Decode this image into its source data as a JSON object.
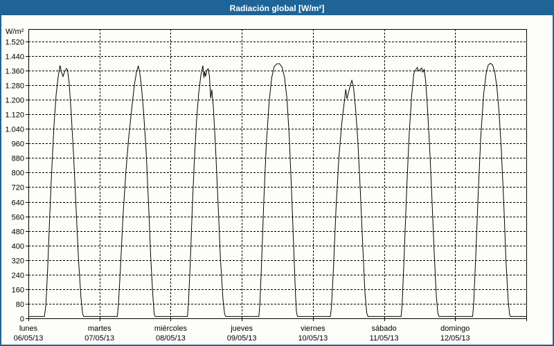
{
  "window": {
    "title": "Radiación global [W/m²]"
  },
  "colors": {
    "titlebar_bg": "#1E6497",
    "titlebar_text": "#FFFFFF",
    "window_border": "#1E6497",
    "background": "#FDFDFA",
    "line": "#000000",
    "grid": "#000000"
  },
  "chart_data": {
    "type": "line",
    "title": "Radiación global [W/m²]",
    "grid": "dashed",
    "legend": "none",
    "line_color": "#000000",
    "ylim": [
      0,
      1588
    ],
    "y_tick_step": 80,
    "y_axis": {
      "unit": "W/m²",
      "ticks": [
        {
          "value": 0,
          "label": "0"
        },
        {
          "value": 80,
          "label": "80"
        },
        {
          "value": 160,
          "label": "160"
        },
        {
          "value": 240,
          "label": "240"
        },
        {
          "value": 320,
          "label": "320"
        },
        {
          "value": 400,
          "label": "400"
        },
        {
          "value": 480,
          "label": "480"
        },
        {
          "value": 560,
          "label": "560"
        },
        {
          "value": 640,
          "label": "640"
        },
        {
          "value": 720,
          "label": "720"
        },
        {
          "value": 800,
          "label": "800"
        },
        {
          "value": 880,
          "label": "880"
        },
        {
          "value": 960,
          "label": "960"
        },
        {
          "value": 1040,
          "label": "1.040"
        },
        {
          "value": 1120,
          "label": "1.120"
        },
        {
          "value": 1200,
          "label": "1.200"
        },
        {
          "value": 1280,
          "label": "1.280"
        },
        {
          "value": 1360,
          "label": "1.360"
        },
        {
          "value": 1440,
          "label": "1.440"
        },
        {
          "value": 1520,
          "label": "1.520"
        }
      ]
    },
    "days": [
      {
        "weekday": "lunes",
        "date": "06/05/13",
        "peak": 1388,
        "profile": [
          [
            0,
            10
          ],
          [
            0.225,
            10
          ],
          [
            0.245,
            70
          ],
          [
            0.27,
            260
          ],
          [
            0.3,
            560
          ],
          [
            0.33,
            830
          ],
          [
            0.36,
            1060
          ],
          [
            0.39,
            1230
          ],
          [
            0.42,
            1330
          ],
          [
            0.445,
            1388
          ],
          [
            0.465,
            1352
          ],
          [
            0.487,
            1328
          ],
          [
            0.51,
            1355
          ],
          [
            0.535,
            1372
          ],
          [
            0.55,
            1362
          ],
          [
            0.572,
            1295
          ],
          [
            0.6,
            1140
          ],
          [
            0.635,
            900
          ],
          [
            0.67,
            610
          ],
          [
            0.705,
            320
          ],
          [
            0.74,
            110
          ],
          [
            0.762,
            25
          ],
          [
            0.778,
            10
          ],
          [
            1,
            10
          ]
        ]
      },
      {
        "weekday": "martes",
        "date": "07/05/13",
        "peak": 1386,
        "profile": [
          [
            0,
            10
          ],
          [
            0.25,
            10
          ],
          [
            0.265,
            70
          ],
          [
            0.295,
            280
          ],
          [
            0.33,
            560
          ],
          [
            0.37,
            800
          ],
          [
            0.41,
            990
          ],
          [
            0.45,
            1140
          ],
          [
            0.49,
            1280
          ],
          [
            0.52,
            1352
          ],
          [
            0.545,
            1386
          ],
          [
            0.565,
            1352
          ],
          [
            0.59,
            1270
          ],
          [
            0.62,
            1130
          ],
          [
            0.655,
            920
          ],
          [
            0.69,
            620
          ],
          [
            0.72,
            330
          ],
          [
            0.75,
            120
          ],
          [
            0.768,
            25
          ],
          [
            0.782,
            10
          ],
          [
            1,
            10
          ]
        ]
      },
      {
        "weekday": "miércoles",
        "date": "08/05/13",
        "peak": 1387,
        "profile": [
          [
            0,
            10
          ],
          [
            0.235,
            10
          ],
          [
            0.25,
            80
          ],
          [
            0.275,
            300
          ],
          [
            0.305,
            620
          ],
          [
            0.335,
            880
          ],
          [
            0.365,
            1090
          ],
          [
            0.395,
            1240
          ],
          [
            0.425,
            1335
          ],
          [
            0.453,
            1387
          ],
          [
            0.468,
            1320
          ],
          [
            0.478,
            1355
          ],
          [
            0.49,
            1328
          ],
          [
            0.51,
            1362
          ],
          [
            0.528,
            1370
          ],
          [
            0.545,
            1330
          ],
          [
            0.562,
            1208
          ],
          [
            0.578,
            1256
          ],
          [
            0.6,
            1160
          ],
          [
            0.63,
            950
          ],
          [
            0.665,
            650
          ],
          [
            0.7,
            330
          ],
          [
            0.735,
            110
          ],
          [
            0.758,
            25
          ],
          [
            0.775,
            10
          ],
          [
            1,
            10
          ]
        ]
      },
      {
        "weekday": "jueves",
        "date": "09/05/13",
        "peak": 1398,
        "profile": [
          [
            0,
            10
          ],
          [
            0.24,
            10
          ],
          [
            0.255,
            80
          ],
          [
            0.28,
            320
          ],
          [
            0.31,
            650
          ],
          [
            0.345,
            960
          ],
          [
            0.385,
            1190
          ],
          [
            0.42,
            1320
          ],
          [
            0.455,
            1382
          ],
          [
            0.49,
            1397
          ],
          [
            0.53,
            1398
          ],
          [
            0.565,
            1380
          ],
          [
            0.6,
            1325
          ],
          [
            0.635,
            1205
          ],
          [
            0.668,
            990
          ],
          [
            0.7,
            700
          ],
          [
            0.73,
            390
          ],
          [
            0.755,
            130
          ],
          [
            0.77,
            30
          ],
          [
            0.785,
            10
          ],
          [
            1,
            10
          ]
        ]
      },
      {
        "weekday": "viernes",
        "date": "10/05/13",
        "peak": 1306,
        "profile": [
          [
            0,
            10
          ],
          [
            0.245,
            10
          ],
          [
            0.26,
            60
          ],
          [
            0.29,
            280
          ],
          [
            0.325,
            600
          ],
          [
            0.365,
            880
          ],
          [
            0.405,
            1070
          ],
          [
            0.44,
            1185
          ],
          [
            0.462,
            1258
          ],
          [
            0.478,
            1205
          ],
          [
            0.5,
            1238
          ],
          [
            0.53,
            1285
          ],
          [
            0.548,
            1306
          ],
          [
            0.558,
            1292
          ],
          [
            0.575,
            1255
          ],
          [
            0.6,
            1150
          ],
          [
            0.632,
            970
          ],
          [
            0.665,
            710
          ],
          [
            0.7,
            400
          ],
          [
            0.732,
            140
          ],
          [
            0.757,
            30
          ],
          [
            0.773,
            10
          ],
          [
            1,
            10
          ]
        ]
      },
      {
        "weekday": "sábado",
        "date": "11/05/13",
        "peak": 1377,
        "profile": [
          [
            0,
            10
          ],
          [
            0.24,
            10
          ],
          [
            0.255,
            80
          ],
          [
            0.285,
            360
          ],
          [
            0.32,
            720
          ],
          [
            0.355,
            1020
          ],
          [
            0.39,
            1230
          ],
          [
            0.42,
            1345
          ],
          [
            0.445,
            1365
          ],
          [
            0.468,
            1377
          ],
          [
            0.482,
            1358
          ],
          [
            0.505,
            1365
          ],
          [
            0.53,
            1374
          ],
          [
            0.545,
            1352
          ],
          [
            0.565,
            1366
          ],
          [
            0.585,
            1300
          ],
          [
            0.61,
            1160
          ],
          [
            0.64,
            950
          ],
          [
            0.672,
            670
          ],
          [
            0.705,
            360
          ],
          [
            0.735,
            120
          ],
          [
            0.758,
            25
          ],
          [
            0.773,
            10
          ],
          [
            1,
            10
          ]
        ]
      },
      {
        "weekday": "domingo",
        "date": "12/05/13",
        "peak": 1400,
        "profile": [
          [
            0,
            10
          ],
          [
            0.245,
            10
          ],
          [
            0.26,
            80
          ],
          [
            0.29,
            350
          ],
          [
            0.325,
            700
          ],
          [
            0.36,
            1000
          ],
          [
            0.4,
            1230
          ],
          [
            0.435,
            1345
          ],
          [
            0.465,
            1390
          ],
          [
            0.495,
            1400
          ],
          [
            0.525,
            1392
          ],
          [
            0.555,
            1355
          ],
          [
            0.585,
            1275
          ],
          [
            0.615,
            1140
          ],
          [
            0.65,
            920
          ],
          [
            0.685,
            620
          ],
          [
            0.715,
            310
          ],
          [
            0.745,
            100
          ],
          [
            0.765,
            20
          ],
          [
            0.78,
            10
          ],
          [
            1,
            10
          ]
        ]
      }
    ]
  }
}
